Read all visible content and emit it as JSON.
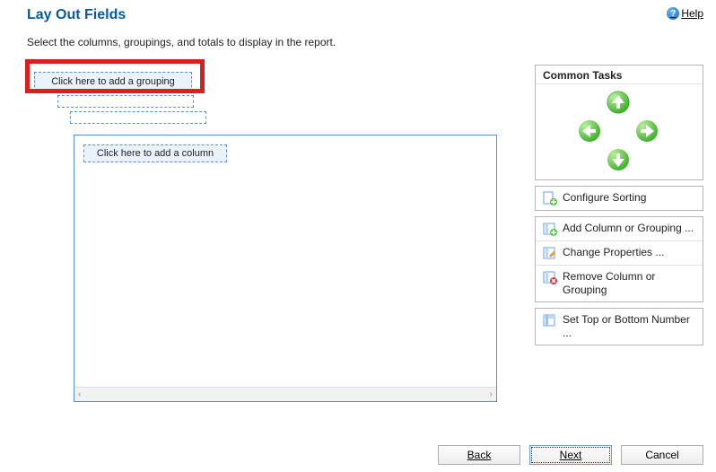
{
  "header": {
    "title": "Lay Out Fields",
    "help_label": "Help"
  },
  "instruction": "Select the columns, groupings, and totals to display in the report.",
  "canvas": {
    "add_grouping_label": "Click here to add a grouping",
    "add_column_label": "Click here to add a column"
  },
  "sidebar": {
    "common_tasks_header": "Common Tasks",
    "arrows": {
      "up": "arrow-up",
      "down": "arrow-down",
      "left": "arrow-left",
      "right": "arrow-right"
    },
    "tasks_group1": [
      {
        "icon": "sort",
        "label": "Configure Sorting"
      }
    ],
    "tasks_group2": [
      {
        "icon": "add-col",
        "label": "Add Column or Grouping ..."
      },
      {
        "icon": "props",
        "label": "Change Properties ..."
      },
      {
        "icon": "remove",
        "label": "Remove Column or Grouping"
      }
    ],
    "tasks_group3": [
      {
        "icon": "topn",
        "label": "Set Top or Bottom Number ..."
      }
    ]
  },
  "footer": {
    "back": "Back",
    "next": "Next",
    "cancel": "Cancel"
  },
  "colors": {
    "title": "#0a5aa0",
    "dashed_border": "#5a8fcf",
    "highlight": "#da1f1f",
    "arrow_green": "#3fae2a"
  }
}
